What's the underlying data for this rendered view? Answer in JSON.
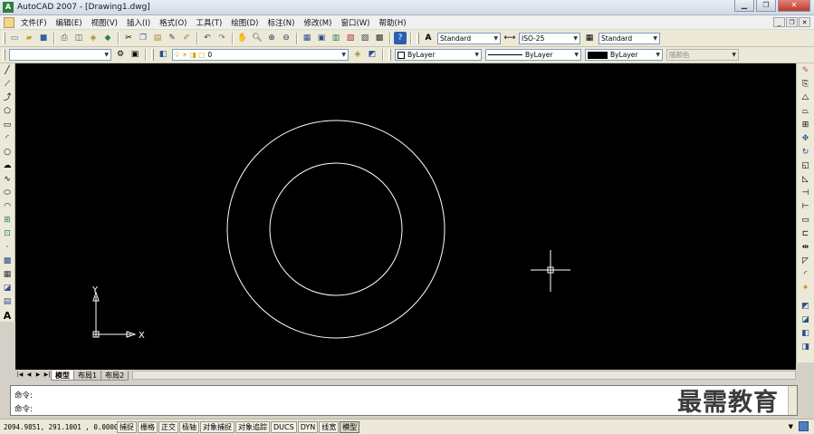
{
  "window": {
    "title": "AutoCAD 2007 - [Drawing1.dwg]",
    "app_icon": "A"
  },
  "menu": {
    "items": [
      "文件(F)",
      "编辑(E)",
      "视图(V)",
      "插入(I)",
      "格式(O)",
      "工具(T)",
      "绘图(D)",
      "标注(N)",
      "修改(M)",
      "窗口(W)",
      "帮助(H)"
    ]
  },
  "styles_toolbar": {
    "text_style": "Standard",
    "dim_style": "ISO-25",
    "table_style": "Standard"
  },
  "layers_toolbar": {
    "layer": "0"
  },
  "properties_toolbar": {
    "color": "ByLayer",
    "linetype": "ByLayer",
    "lineweight": "ByLayer",
    "plot_style": "随颜色"
  },
  "ucs": {
    "x_label": "X",
    "y_label": "Y"
  },
  "layout_tabs": [
    "模型",
    "布局1",
    "布局2"
  ],
  "command": {
    "line1": "命令:",
    "line2": "命令:"
  },
  "watermark": "最需教育",
  "status": {
    "coordinates": "2094.9851, 291.1001 , 0.0000",
    "toggles": [
      {
        "label": "捕捉",
        "on": false
      },
      {
        "label": "栅格",
        "on": false
      },
      {
        "label": "正交",
        "on": false
      },
      {
        "label": "极轴",
        "on": false
      },
      {
        "label": "对象捕捉",
        "on": false
      },
      {
        "label": "对象追踪",
        "on": false
      },
      {
        "label": "DUCS",
        "on": false
      },
      {
        "label": "DYN",
        "on": false
      },
      {
        "label": "线宽",
        "on": false
      },
      {
        "label": "模型",
        "on": true
      }
    ]
  },
  "colors": {
    "canvas": "#000000",
    "geometry": "#ffffff"
  }
}
